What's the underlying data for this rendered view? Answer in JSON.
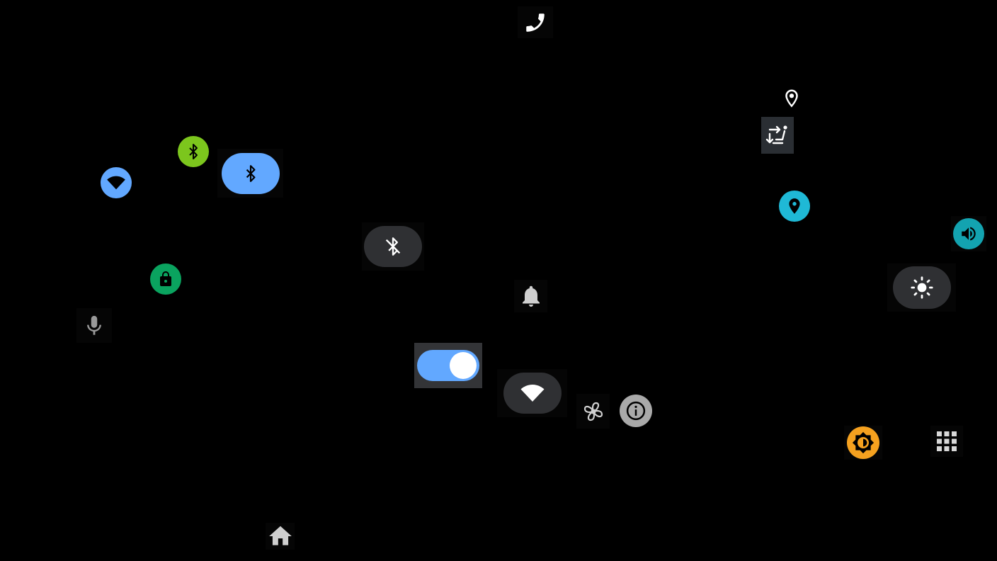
{
  "screen": {
    "background": "#000000"
  },
  "icons": {
    "phone": {
      "name": "phone-icon",
      "color": "#ffffff",
      "tile_bg": "#050505"
    },
    "location_outline": {
      "name": "location-pin-outline-icon",
      "color": "#ffffff"
    },
    "seat_adjust": {
      "name": "seat-adjust-icon",
      "color": "#ffffff",
      "tile_bg": "#2a2e33"
    },
    "bluetooth_green": {
      "name": "bluetooth-icon",
      "bg": "#7cc61d"
    },
    "bluetooth_toggle_on": {
      "name": "bluetooth-toggle-on",
      "bg": "#62a8ff"
    },
    "wifi_blue": {
      "name": "wifi-icon",
      "bg": "#62a8ff"
    },
    "location_cyan": {
      "name": "location-pin-icon",
      "bg": "#1fb9d6"
    },
    "volume": {
      "name": "volume-icon",
      "bg": "#13a3b0"
    },
    "bluetooth_disabled": {
      "name": "bluetooth-disabled-toggle",
      "bg": "#2f3033"
    },
    "brightness": {
      "name": "brightness-toggle",
      "bg": "#2f3033"
    },
    "lock": {
      "name": "lock-icon",
      "bg": "#0aa35f"
    },
    "bell": {
      "name": "notification-bell-icon",
      "color": "#cfcfcf"
    },
    "mic": {
      "name": "microphone-icon",
      "color": "#9a9a9a"
    },
    "switch": {
      "name": "toggle-switch",
      "state": "on",
      "track": "#62a8ff",
      "knob": "#ffffff",
      "tile_bg": "#333437"
    },
    "wifi_toggle": {
      "name": "wifi-toggle",
      "bg": "#2f3033"
    },
    "fan": {
      "name": "fan-icon",
      "color": "#d0d0d0"
    },
    "info": {
      "name": "info-icon",
      "bg": "#a9a9a9"
    },
    "brightness_auto": {
      "name": "auto-brightness-icon",
      "bg": "#f5a11f"
    },
    "apps_grid": {
      "name": "app-grid-icon",
      "color": "#d9d9d9"
    },
    "home": {
      "name": "home-icon",
      "color": "#cfcfcf"
    }
  }
}
